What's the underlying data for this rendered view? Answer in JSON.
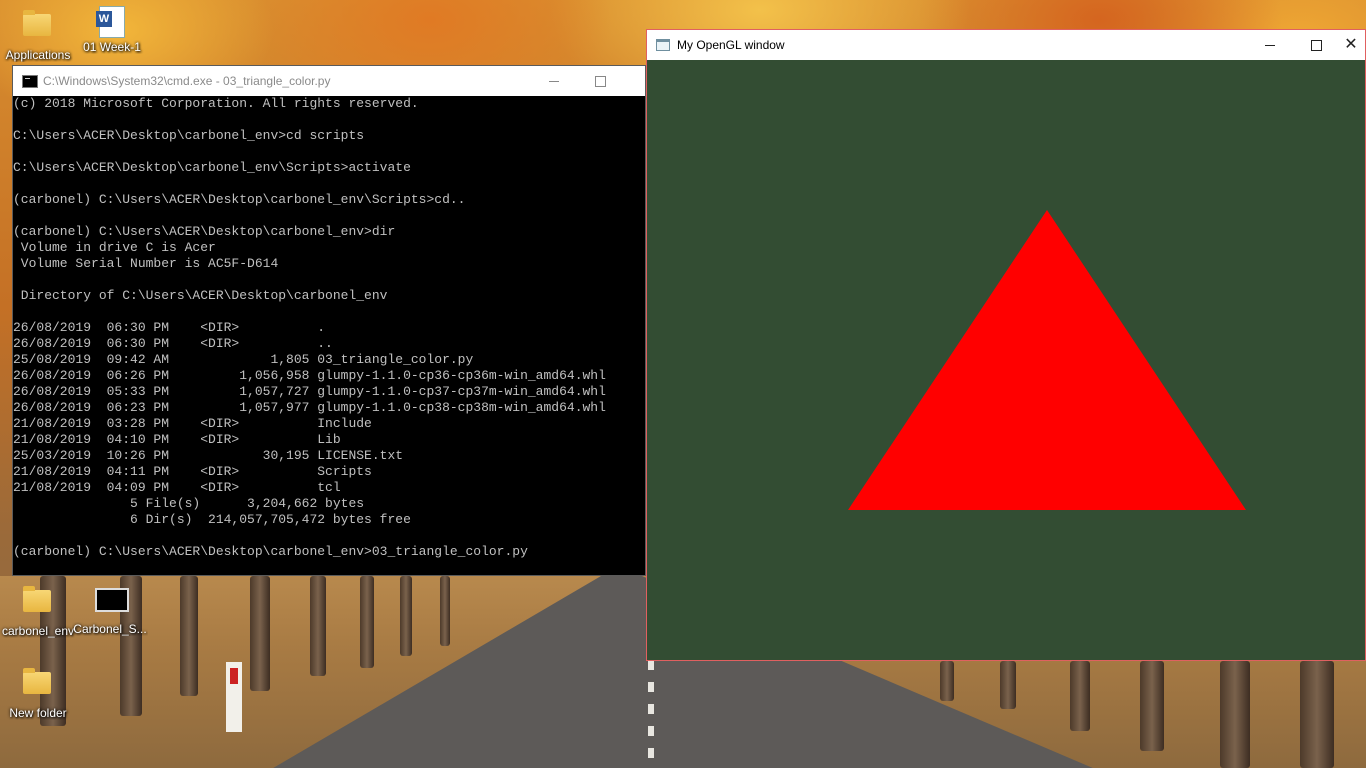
{
  "desktop": {
    "icons": [
      {
        "label": "Applications",
        "icon": "folder-icon"
      },
      {
        "label": "01 Week-1",
        "icon": "word-document-icon"
      },
      {
        "label": "carbonel_env",
        "icon": "folder-icon"
      },
      {
        "label": "Carbonel_S...",
        "icon": "shortcut-console-icon"
      },
      {
        "label": "New folder",
        "icon": "folder-icon"
      }
    ]
  },
  "cmd_window": {
    "title": "C:\\Windows\\System32\\cmd.exe - 03_triangle_color.py",
    "lines": [
      "(c) 2018 Microsoft Corporation. All rights reserved.",
      "",
      "C:\\Users\\ACER\\Desktop\\carbonel_env>cd scripts",
      "",
      "C:\\Users\\ACER\\Desktop\\carbonel_env\\Scripts>activate",
      "",
      "(carbonel) C:\\Users\\ACER\\Desktop\\carbonel_env\\Scripts>cd..",
      "",
      "(carbonel) C:\\Users\\ACER\\Desktop\\carbonel_env>dir",
      " Volume in drive C is Acer",
      " Volume Serial Number is AC5F-D614",
      "",
      " Directory of C:\\Users\\ACER\\Desktop\\carbonel_env",
      "",
      "26/08/2019  06:30 PM    <DIR>          .",
      "26/08/2019  06:30 PM    <DIR>          ..",
      "25/08/2019  09:42 AM             1,805 03_triangle_color.py",
      "26/08/2019  06:26 PM         1,056,958 glumpy-1.1.0-cp36-cp36m-win_amd64.whl",
      "26/08/2019  05:33 PM         1,057,727 glumpy-1.1.0-cp37-cp37m-win_amd64.whl",
      "26/08/2019  06:23 PM         1,057,977 glumpy-1.1.0-cp38-cp38m-win_amd64.whl",
      "21/08/2019  03:28 PM    <DIR>          Include",
      "21/08/2019  04:10 PM    <DIR>          Lib",
      "25/03/2019  10:26 PM            30,195 LICENSE.txt",
      "21/08/2019  04:11 PM    <DIR>          Scripts",
      "21/08/2019  04:09 PM    <DIR>          tcl",
      "               5 File(s)      3,204,662 bytes",
      "               6 Dir(s)  214,057,705,472 bytes free",
      "",
      "(carbonel) C:\\Users\\ACER\\Desktop\\carbonel_env>03_triangle_color.py"
    ]
  },
  "gl_window": {
    "title": "My OpenGL window",
    "clear_color": "#334d33",
    "triangle_color": "#ff0000"
  }
}
